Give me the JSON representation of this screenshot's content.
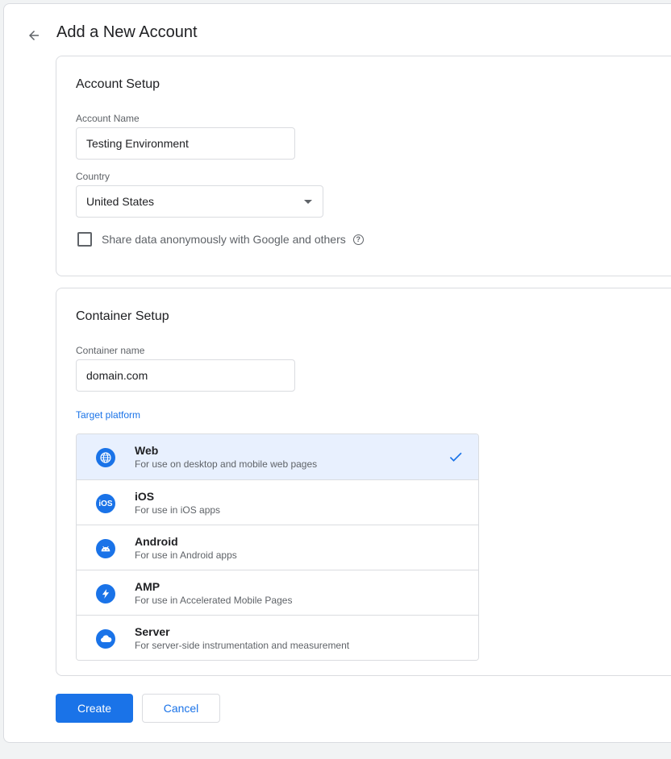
{
  "header": {
    "title": "Add a New Account"
  },
  "account_setup": {
    "title": "Account Setup",
    "account_name_label": "Account Name",
    "account_name_value": "Testing Environment",
    "country_label": "Country",
    "country_value": "United States",
    "share_data_label": "Share data anonymously with Google and others",
    "share_data_checked": false
  },
  "container_setup": {
    "title": "Container Setup",
    "container_name_label": "Container name",
    "container_name_value": "domain.com",
    "target_platform_label": "Target platform",
    "platforms": [
      {
        "name": "Web",
        "desc": "For use on desktop and mobile web pages",
        "icon": "globe-icon",
        "selected": true
      },
      {
        "name": "iOS",
        "desc": "For use in iOS apps",
        "icon": "ios-icon",
        "selected": false
      },
      {
        "name": "Android",
        "desc": "For use in Android apps",
        "icon": "android-icon",
        "selected": false
      },
      {
        "name": "AMP",
        "desc": "For use in Accelerated Mobile Pages",
        "icon": "amp-bolt-icon",
        "selected": false
      },
      {
        "name": "Server",
        "desc": "For server-side instrumentation and measurement",
        "icon": "cloud-icon",
        "selected": false
      }
    ]
  },
  "actions": {
    "create_label": "Create",
    "cancel_label": "Cancel"
  },
  "colors": {
    "accent": "#1a73e8",
    "selected_bg": "#e8f0fe",
    "border": "#dadce0",
    "muted_text": "#5f6368"
  }
}
